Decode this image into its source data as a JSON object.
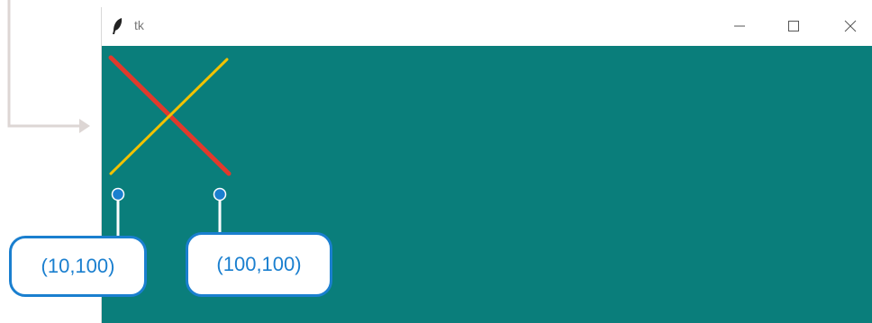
{
  "window": {
    "title": "tk",
    "icon": "feather-icon",
    "controls": {
      "minimize_icon": "minimize-icon",
      "maximize_icon": "maximize-icon",
      "close_icon": "close-icon"
    }
  },
  "canvas": {
    "background_color": "#0a7e7b",
    "lines": [
      {
        "name": "red-line",
        "color": "#e03a2c"
      },
      {
        "name": "yellow-line",
        "color": "#f2c200"
      }
    ]
  },
  "annotations": {
    "point_left_label": "(10,100)",
    "point_right_label": "(100,100)",
    "accent_color": "#1a7fcf"
  }
}
